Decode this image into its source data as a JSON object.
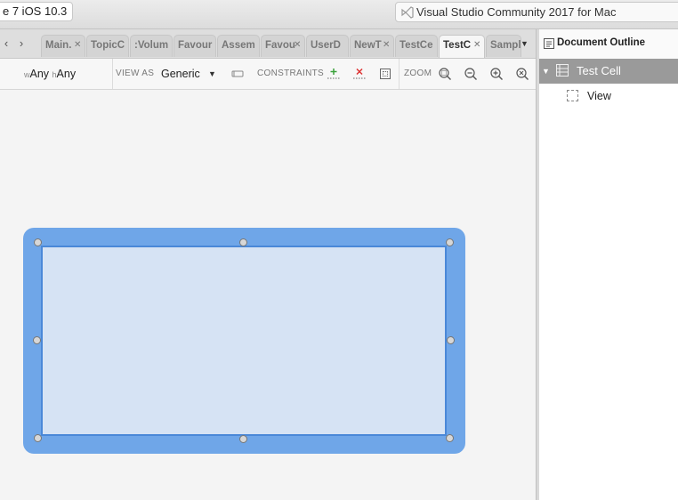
{
  "titlebar": {
    "device": "e 7 iOS 10.3",
    "app_title": "Visual Studio Community 2017 for Mac"
  },
  "tabs": [
    {
      "label": "Main.",
      "active": false
    },
    {
      "label": "TopicC",
      "active": false
    },
    {
      "label": ":Volum",
      "active": false
    },
    {
      "label": "Favour",
      "active": false
    },
    {
      "label": "Assem",
      "active": false
    },
    {
      "label": "Favou",
      "active": false
    },
    {
      "label": "UserD",
      "active": false
    },
    {
      "label": "NewT",
      "active": false
    },
    {
      "label": "TestCe",
      "active": false
    },
    {
      "label": "TestC",
      "active": true
    },
    {
      "label": "Sampl",
      "active": false
    }
  ],
  "toolbar": {
    "size_w_prefix": "w",
    "size_w_value": "Any",
    "size_h_prefix": "h",
    "size_h_value": "Any",
    "view_as_label": "VIEW AS",
    "view_as_value": "Generic",
    "constraints_label": "CONSTRAINTS",
    "zoom_label": "ZOOM"
  },
  "outline": {
    "title": "Document Outline",
    "items": [
      {
        "label": "Test Cell",
        "icon": "table-cell-icon",
        "selected": true,
        "expanded": true
      },
      {
        "label": "View",
        "icon": "view-icon",
        "selected": false
      }
    ]
  },
  "colors": {
    "selection_frame": "#6fa6e8",
    "view_fill": "#d6e3f4",
    "view_border": "#4a88d8",
    "outline_selection": "#9a9a9a"
  }
}
